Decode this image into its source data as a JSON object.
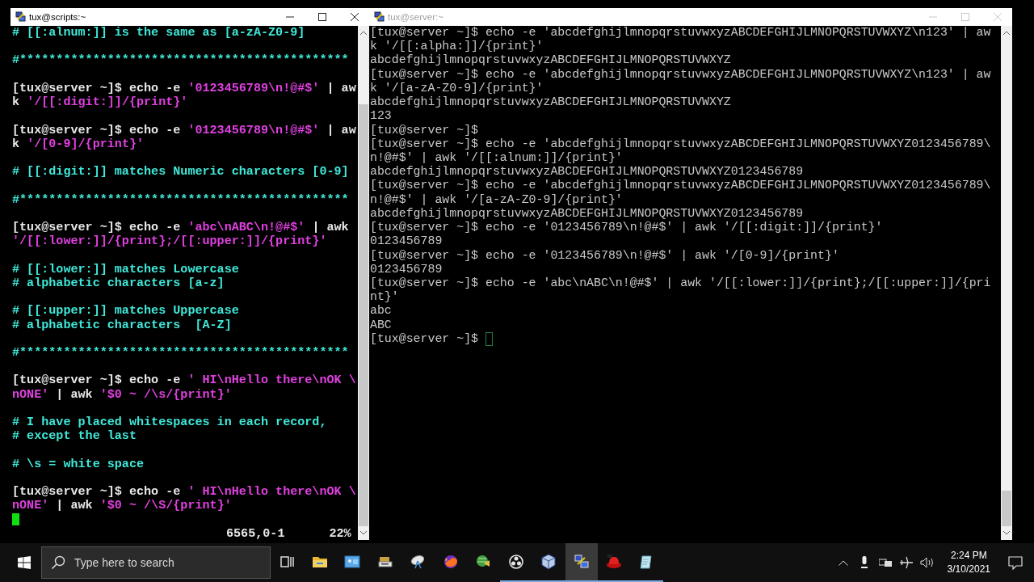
{
  "windows": [
    {
      "title": "tux@scripts:~",
      "active": true,
      "lines": [
        {
          "kind": "text",
          "segments": [
            {
              "kind": "comment",
              "text": "# [[:alnum:]] is the same as [a-zA-Z0-9]"
            }
          ]
        },
        {
          "kind": "blank"
        },
        {
          "kind": "text",
          "segments": [
            {
              "kind": "comment",
              "text": "#*********************************************"
            }
          ]
        },
        {
          "kind": "blank"
        },
        {
          "kind": "text",
          "segments": [
            {
              "kind": "plain",
              "text": "[tux@server ~]$ echo -e "
            },
            {
              "kind": "string",
              "text": "'0123456789\\n!@#$'"
            },
            {
              "kind": "plain",
              "text": " | aw"
            }
          ]
        },
        {
          "kind": "text",
          "segments": [
            {
              "kind": "plain",
              "text": "k "
            },
            {
              "kind": "string",
              "text": "'/[[:digit:]]/{print}'"
            }
          ]
        },
        {
          "kind": "blank"
        },
        {
          "kind": "text",
          "segments": [
            {
              "kind": "plain",
              "text": "[tux@server ~]$ echo -e "
            },
            {
              "kind": "string",
              "text": "'0123456789\\n!@#$'"
            },
            {
              "kind": "plain",
              "text": " | aw"
            }
          ]
        },
        {
          "kind": "text",
          "segments": [
            {
              "kind": "plain",
              "text": "k "
            },
            {
              "kind": "string",
              "text": "'/[0-9]/{print}'"
            }
          ]
        },
        {
          "kind": "blank"
        },
        {
          "kind": "text",
          "segments": [
            {
              "kind": "comment",
              "text": "# [[:digit:]] matches Numeric characters [0-9]"
            }
          ]
        },
        {
          "kind": "blank"
        },
        {
          "kind": "text",
          "segments": [
            {
              "kind": "comment",
              "text": "#*********************************************"
            }
          ]
        },
        {
          "kind": "blank"
        },
        {
          "kind": "text",
          "segments": [
            {
              "kind": "plain",
              "text": "[tux@server ~]$ echo -e "
            },
            {
              "kind": "string",
              "text": "'abc\\nABC\\n!@#$'"
            },
            {
              "kind": "plain",
              "text": " | awk"
            }
          ]
        },
        {
          "kind": "text",
          "segments": [
            {
              "kind": "string",
              "text": "'/[[:lower:]]/{print};/[[:upper:]]/{print}'"
            }
          ]
        },
        {
          "kind": "blank"
        },
        {
          "kind": "text",
          "segments": [
            {
              "kind": "comment",
              "text": "# [[:lower:]] matches Lowercase"
            }
          ]
        },
        {
          "kind": "text",
          "segments": [
            {
              "kind": "comment",
              "text": "# alphabetic characters [a-z]"
            }
          ]
        },
        {
          "kind": "blank"
        },
        {
          "kind": "text",
          "segments": [
            {
              "kind": "comment",
              "text": "# [[:upper:]] matches Uppercase"
            }
          ]
        },
        {
          "kind": "text",
          "segments": [
            {
              "kind": "comment",
              "text": "# alphabetic characters  [A-Z]"
            }
          ]
        },
        {
          "kind": "blank"
        },
        {
          "kind": "text",
          "segments": [
            {
              "kind": "comment",
              "text": "#*********************************************"
            }
          ]
        },
        {
          "kind": "blank"
        },
        {
          "kind": "text",
          "segments": [
            {
              "kind": "plain",
              "text": "[tux@server ~]$ echo -e "
            },
            {
              "kind": "string",
              "text": "' HI\\nHello there\\nOK \\"
            }
          ]
        },
        {
          "kind": "text",
          "segments": [
            {
              "kind": "string",
              "text": "nONE'"
            },
            {
              "kind": "plain",
              "text": " | awk "
            },
            {
              "kind": "string",
              "text": "'$0 ~ /\\s/{print}'"
            }
          ]
        },
        {
          "kind": "blank"
        },
        {
          "kind": "text",
          "segments": [
            {
              "kind": "comment",
              "text": "# I have placed whitespaces in each record,"
            }
          ]
        },
        {
          "kind": "text",
          "segments": [
            {
              "kind": "comment",
              "text": "# except the last"
            }
          ]
        },
        {
          "kind": "blank"
        },
        {
          "kind": "text",
          "segments": [
            {
              "kind": "comment",
              "text": "# \\s = white space"
            }
          ]
        },
        {
          "kind": "blank"
        },
        {
          "kind": "text",
          "segments": [
            {
              "kind": "plain",
              "text": "[tux@server ~]$ echo -e "
            },
            {
              "kind": "string",
              "text": "' HI\\nHello there\\nOK \\"
            }
          ]
        },
        {
          "kind": "text",
          "segments": [
            {
              "kind": "string",
              "text": "nONE'"
            },
            {
              "kind": "plain",
              "text": " | awk "
            },
            {
              "kind": "string",
              "text": "'$0 ~ /\\S/{print}'"
            }
          ]
        },
        {
          "kind": "blank"
        }
      ],
      "status": {
        "position": "6565,0-1",
        "percent": "22%"
      }
    },
    {
      "title": "tux@server:~",
      "active": false,
      "lines": [
        {
          "kind": "text",
          "segments": [
            {
              "kind": "plain",
              "text": "[tux@server ~]$ echo -e 'abcdefghijlmnopqrstuvwxyzABCDEFGHIJLMNOPQRSTUVWXYZ\\n123' | aw"
            }
          ]
        },
        {
          "kind": "text",
          "segments": [
            {
              "kind": "plain",
              "text": "k '/[[:alpha:]]/{print}'"
            }
          ]
        },
        {
          "kind": "text",
          "segments": [
            {
              "kind": "plain",
              "text": "abcdefghijlmnopqrstuvwxyzABCDEFGHIJLMNOPQRSTUVWXYZ"
            }
          ]
        },
        {
          "kind": "text",
          "segments": [
            {
              "kind": "plain",
              "text": "[tux@server ~]$ echo -e 'abcdefghijlmnopqrstuvwxyzABCDEFGHIJLMNOPQRSTUVWXYZ\\n123' | aw"
            }
          ]
        },
        {
          "kind": "text",
          "segments": [
            {
              "kind": "plain",
              "text": "k '/[a-zA-Z0-9]/{print}'"
            }
          ]
        },
        {
          "kind": "text",
          "segments": [
            {
              "kind": "plain",
              "text": "abcdefghijlmnopqrstuvwxyzABCDEFGHIJLMNOPQRSTUVWXYZ"
            }
          ]
        },
        {
          "kind": "text",
          "segments": [
            {
              "kind": "plain",
              "text": "123"
            }
          ]
        },
        {
          "kind": "text",
          "segments": [
            {
              "kind": "plain",
              "text": "[tux@server ~]$"
            }
          ]
        },
        {
          "kind": "text",
          "segments": [
            {
              "kind": "plain",
              "text": "[tux@server ~]$ echo -e 'abcdefghijlmnopqrstuvwxyzABCDEFGHIJLMNOPQRSTUVWXYZ0123456789\\"
            }
          ]
        },
        {
          "kind": "text",
          "segments": [
            {
              "kind": "plain",
              "text": "n!@#$' | awk '/[[:alnum:]]/{print}'"
            }
          ]
        },
        {
          "kind": "text",
          "segments": [
            {
              "kind": "plain",
              "text": "abcdefghijlmnopqrstuvwxyzABCDEFGHIJLMNOPQRSTUVWXYZ0123456789"
            }
          ]
        },
        {
          "kind": "text",
          "segments": [
            {
              "kind": "plain",
              "text": "[tux@server ~]$ echo -e 'abcdefghijlmnopqrstuvwxyzABCDEFGHIJLMNOPQRSTUVWXYZ0123456789\\"
            }
          ]
        },
        {
          "kind": "text",
          "segments": [
            {
              "kind": "plain",
              "text": "n!@#$' | awk '/[a-zA-Z0-9]/{print}'"
            }
          ]
        },
        {
          "kind": "text",
          "segments": [
            {
              "kind": "plain",
              "text": "abcdefghijlmnopqrstuvwxyzABCDEFGHIJLMNOPQRSTUVWXYZ0123456789"
            }
          ]
        },
        {
          "kind": "text",
          "segments": [
            {
              "kind": "plain",
              "text": "[tux@server ~]$ echo -e '0123456789\\n!@#$' | awk '/[[:digit:]]/{print}'"
            }
          ]
        },
        {
          "kind": "text",
          "segments": [
            {
              "kind": "plain",
              "text": "0123456789"
            }
          ]
        },
        {
          "kind": "text",
          "segments": [
            {
              "kind": "plain",
              "text": "[tux@server ~]$ echo -e '0123456789\\n!@#$' | awk '/[0-9]/{print}'"
            }
          ]
        },
        {
          "kind": "text",
          "segments": [
            {
              "kind": "plain",
              "text": "0123456789"
            }
          ]
        },
        {
          "kind": "text",
          "segments": [
            {
              "kind": "plain",
              "text": "[tux@server ~]$ echo -e 'abc\\nABC\\n!@#$' | awk '/[[:lower:]]/{print};/[[:upper:]]/{pri"
            }
          ]
        },
        {
          "kind": "text",
          "segments": [
            {
              "kind": "plain",
              "text": "nt}'"
            }
          ]
        },
        {
          "kind": "text",
          "segments": [
            {
              "kind": "plain",
              "text": "abc"
            }
          ]
        },
        {
          "kind": "text",
          "segments": [
            {
              "kind": "plain",
              "text": "ABC"
            }
          ]
        },
        {
          "kind": "text",
          "segments": [
            {
              "kind": "plain",
              "text": "[tux@server ~]$ "
            }
          ]
        }
      ]
    }
  ],
  "taskbar": {
    "search": {
      "placeholder": "Type here to search"
    },
    "apps": [
      {
        "kind": "taskview",
        "running": false,
        "active": false
      },
      {
        "kind": "folder",
        "running": false,
        "active": false
      },
      {
        "kind": "panel",
        "running": false,
        "active": false
      },
      {
        "kind": "scanner",
        "running": false,
        "active": false
      },
      {
        "kind": "dish",
        "running": false,
        "active": false
      },
      {
        "kind": "browser",
        "running": false,
        "active": false
      },
      {
        "kind": "globe",
        "running": false,
        "active": false
      },
      {
        "kind": "recorder",
        "running": true,
        "active": false
      },
      {
        "kind": "cube",
        "running": true,
        "active": false
      },
      {
        "kind": "terminal",
        "running": true,
        "active": true
      },
      {
        "kind": "hat",
        "running": true,
        "active": false
      },
      {
        "kind": "notepad",
        "running": true,
        "active": false
      }
    ],
    "time": "2:24 PM",
    "date": "3/10/2021"
  }
}
